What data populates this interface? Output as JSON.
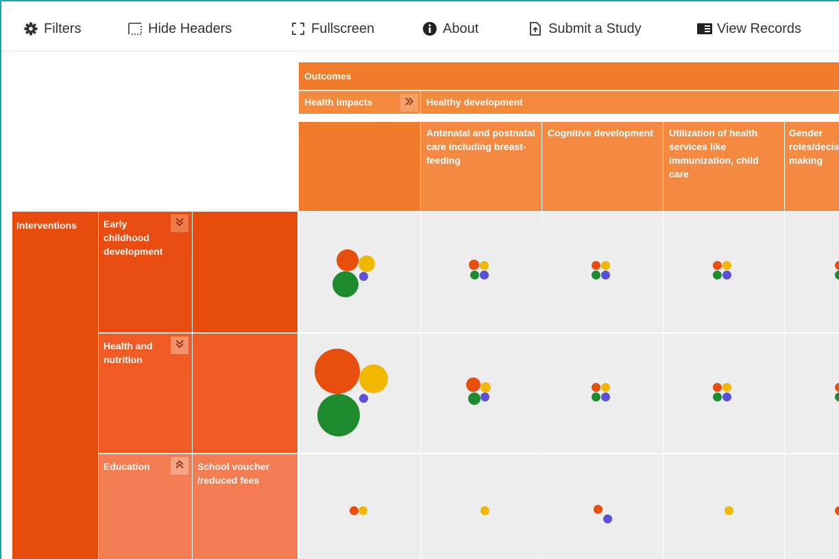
{
  "toolbar": {
    "filters": "Filters",
    "hide_headers": "Hide Headers",
    "fullscreen": "Fullscreen",
    "about": "About",
    "submit_study": "Submit a Study",
    "view_records": "View Records"
  },
  "grid": {
    "outcomes_label": "Outcomes",
    "health_impacts_label": "Health impacts",
    "healthy_development_label": "Healthy development",
    "columns": [
      "Antenatal and postnatal care including breast-feeding",
      "Cognitive development",
      "Utilization of health services like immunization, child care",
      "Gender roles/decision making"
    ],
    "interventions_label": "Interventions",
    "rows": [
      {
        "label": "Early childhood development",
        "sub": ""
      },
      {
        "label": "Health and nutrition",
        "sub": ""
      },
      {
        "label": "Education",
        "sub": "School voucher /reduced fees"
      }
    ]
  },
  "colors": {
    "orange_red": "#e84e0e",
    "yellow": "#f0b800",
    "green": "#1e8c2e",
    "blue": "#5a4fd8",
    "header_orange": "#f07c2b",
    "intervention_red": "#e84b0e"
  }
}
